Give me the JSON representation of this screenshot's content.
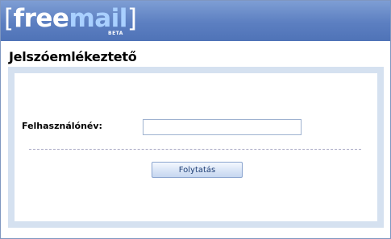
{
  "brand": {
    "bracket_open": "[",
    "logo_free": "free",
    "logo_mail": "mail",
    "bracket_close": "]",
    "badge": "BETA"
  },
  "page": {
    "title": "Jelszóemlékeztető"
  },
  "form": {
    "username_label": "Felhasználónév:",
    "username_value": "",
    "username_placeholder": "",
    "submit_label": "Folytatás"
  },
  "colors": {
    "header": "#5c7fc1",
    "logo_accent": "#a9d0ff",
    "panel_border": "#d5e1f0",
    "button_text": "#1f3f75"
  }
}
